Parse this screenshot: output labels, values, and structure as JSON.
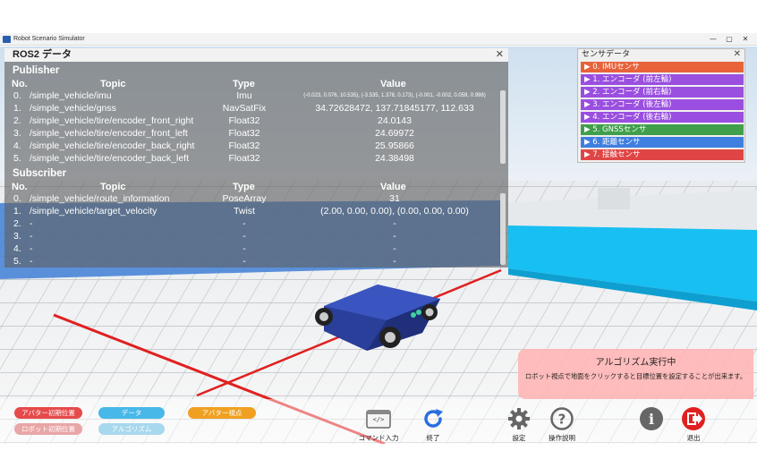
{
  "window": {
    "title": "Robot Scenario Simulator",
    "controls": [
      "—",
      "▢",
      "✕"
    ]
  },
  "ros_panel": {
    "title": "ROS2 データ",
    "close": "✕",
    "publisher": {
      "label": "Publisher",
      "headers": {
        "no": "No.",
        "topic": "Topic",
        "type": "Type",
        "value": "Value"
      },
      "rows": [
        {
          "no": "0.",
          "topic": "/simple_vehicle/imu",
          "type": "Imu",
          "value": "(-0.023, 0.076, 10.535), (-3.535, 1.378, 0.173), (-0.001, -0.002, 0.059, 0.998)"
        },
        {
          "no": "1.",
          "topic": "/simple_vehicle/gnss",
          "type": "NavSatFix",
          "value": "34.72628472, 137.71845177, 112.633"
        },
        {
          "no": "2.",
          "topic": "/simple_vehicle/tire/encoder_front_right",
          "type": "Float32",
          "value": "24.0143"
        },
        {
          "no": "3.",
          "topic": "/simple_vehicle/tire/encoder_front_left",
          "type": "Float32",
          "value": "24.69972"
        },
        {
          "no": "4.",
          "topic": "/simple_vehicle/tire/encoder_back_right",
          "type": "Float32",
          "value": "25.95866"
        },
        {
          "no": "5.",
          "topic": "/simple_vehicle/tire/encoder_back_left",
          "type": "Float32",
          "value": "24.38498"
        }
      ]
    },
    "subscriber": {
      "label": "Subscriber",
      "headers": {
        "no": "No.",
        "topic": "Topic",
        "type": "Type",
        "value": "Value"
      },
      "rows": [
        {
          "no": "0.",
          "topic": "/simple_vehicle/route_information",
          "type": "PoseArray",
          "value": "31"
        },
        {
          "no": "1.",
          "topic": "/simple_vehicle/target_velocity",
          "type": "Twist",
          "value": "(2.00, 0.00, 0.00), (0.00, 0.00, 0.00)"
        },
        {
          "no": "2.",
          "topic": "-",
          "type": "-",
          "value": "-"
        },
        {
          "no": "3.",
          "topic": "-",
          "type": "-",
          "value": "-"
        },
        {
          "no": "4.",
          "topic": "-",
          "type": "-",
          "value": "-"
        },
        {
          "no": "5.",
          "topic": "-",
          "type": "-",
          "value": "-"
        }
      ]
    }
  },
  "sensor_panel": {
    "title": "センサデータ",
    "close": "✕",
    "items": [
      {
        "label": "▶ 0. IMUセンサ",
        "color": "#e8623a"
      },
      {
        "label": "▶ 1. エンコーダ (前左輪)",
        "color": "#9a4fe0"
      },
      {
        "label": "▶ 2. エンコーダ (前右輪)",
        "color": "#9a4fe0"
      },
      {
        "label": "▶ 3. エンコーダ (後左輪)",
        "color": "#9a4fe0"
      },
      {
        "label": "▶ 4. エンコーダ (後右輪)",
        "color": "#9a4fe0"
      },
      {
        "label": "▶ 5. GNSSセンサ",
        "color": "#3f9f4a"
      },
      {
        "label": "▶ 6. 距離センサ",
        "color": "#3f7fe0"
      },
      {
        "label": "▶ 7. 接触センサ",
        "color": "#e04545"
      }
    ]
  },
  "algorithm_dialog": {
    "title": "アルゴリズム実行中",
    "message": "ロボット視点で地面をクリックすると目標位置を設定することが出来ます。"
  },
  "toolbar": {
    "pills": [
      {
        "label": "アバター初期位置",
        "color": "#e64a4a"
      },
      {
        "label": "データ",
        "color": "#48b8e8"
      },
      {
        "label": "アバター視点",
        "color": "#f0a020"
      },
      {
        "label": "ロボット初期位置",
        "color": "#e8a6a6"
      },
      {
        "label": "アルゴリズム",
        "color": "#a8d8ee"
      }
    ],
    "buttons": {
      "command": "コマンド入力",
      "stop": "終了",
      "settings": "設定",
      "help": "操作説明",
      "info": "",
      "exit": "退出"
    },
    "command_icon_text": "</>"
  }
}
